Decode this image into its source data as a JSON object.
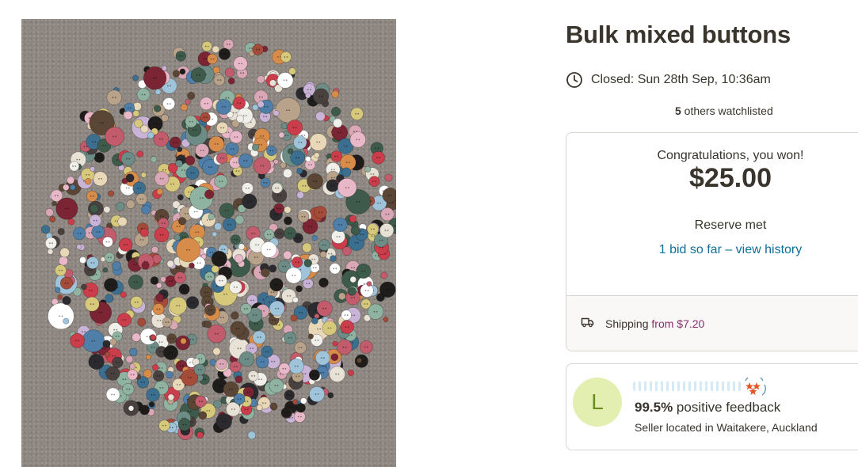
{
  "listing": {
    "title": "Bulk mixed buttons",
    "closed_text": "Closed: Sun 28th Sep, 10:36am",
    "watchlist_count": "5",
    "watchlist_suffix": " others watchlisted"
  },
  "icons": {
    "clock": "clock-icon",
    "shipping": "truck-icon",
    "stars": "star-badge-icon"
  },
  "bid_card": {
    "congrats": "Congratulations, you won!",
    "price": "$25.00",
    "reserve": "Reserve met",
    "bid_history_link": "1 bid so far – view history",
    "shipping_label": "Shipping",
    "shipping_from": "from $7.20"
  },
  "seller": {
    "avatar_letter": "L",
    "feedback_percent": "99.5%",
    "feedback_label": " positive feedback",
    "location": "Seller located in Waitakere, Auckland"
  },
  "colors": {
    "link": "#0f6f97",
    "accent_from": "#8a2e6b",
    "avatar_bg": "#e3efb1",
    "avatar_fg": "#6c8e1c",
    "text": "#39352d"
  }
}
